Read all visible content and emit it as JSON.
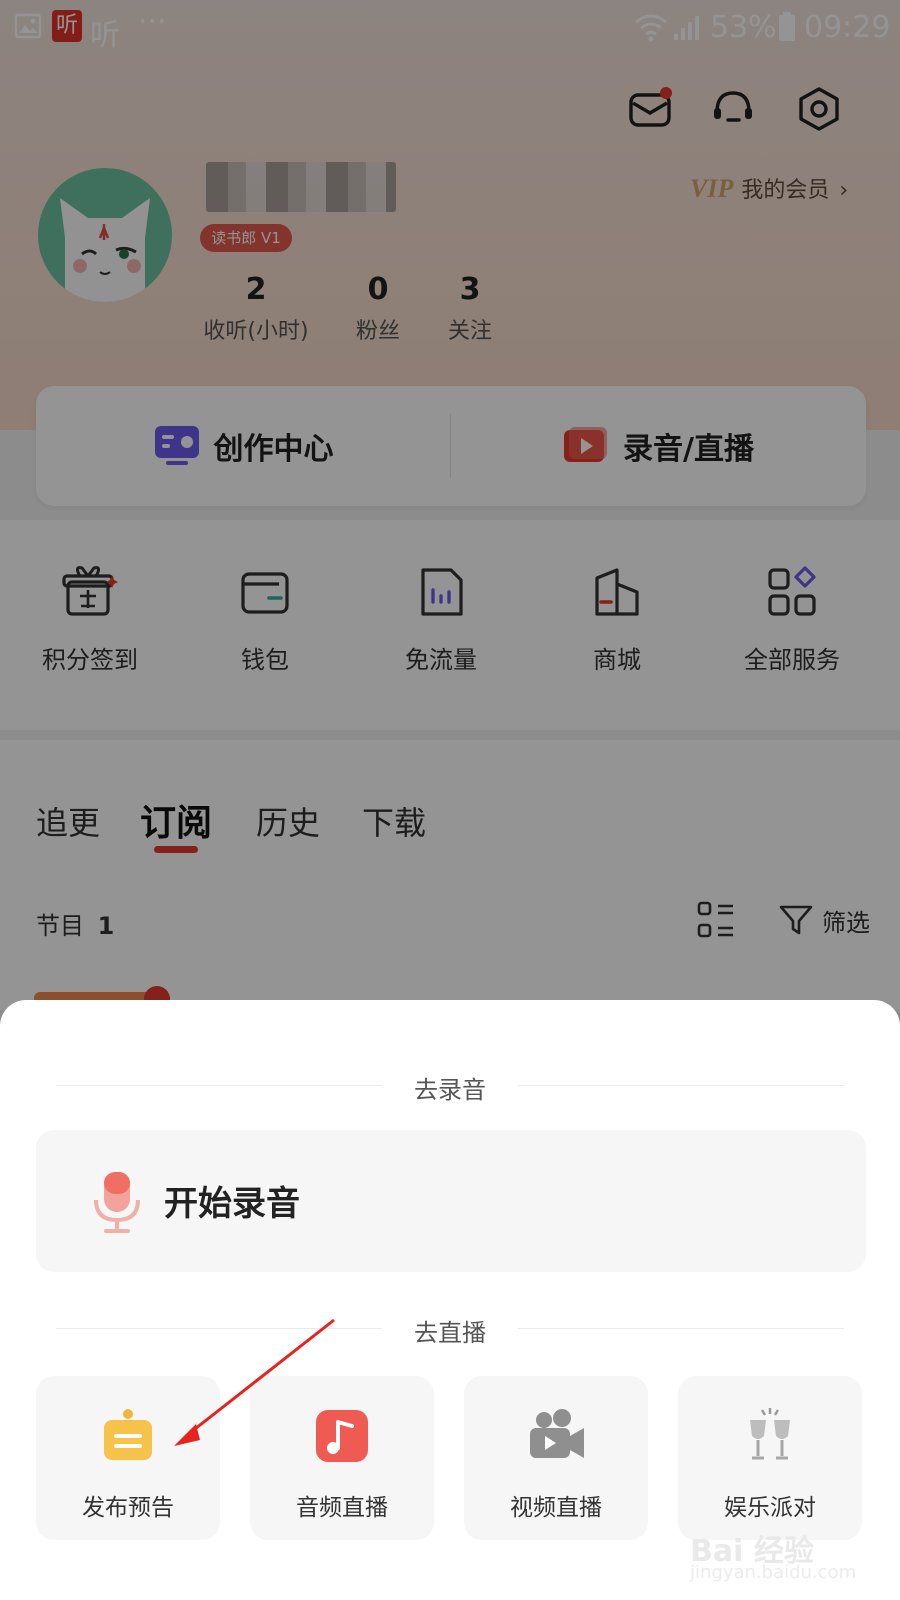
{
  "status_bar": {
    "battery": "53%",
    "time": "09:29",
    "app_badge": "听",
    "app_name": "听",
    "more": "···"
  },
  "profile": {
    "level_badge": "读书郎 V1",
    "vip_logo": "VIP",
    "vip_label": "我的会员",
    "stats": [
      {
        "value": "2",
        "label": "收听(小时)"
      },
      {
        "value": "0",
        "label": "粉丝"
      },
      {
        "value": "3",
        "label": "关注"
      }
    ]
  },
  "creator_card": {
    "left_label": "创作中心",
    "right_label": "录音/直播"
  },
  "services": [
    {
      "label": "积分签到",
      "icon": "gift-sign-icon"
    },
    {
      "label": "钱包",
      "icon": "wallet-icon"
    },
    {
      "label": "免流量",
      "icon": "data-chart-icon"
    },
    {
      "label": "商城",
      "icon": "shop-icon"
    },
    {
      "label": "全部服务",
      "icon": "grid-services-icon"
    }
  ],
  "tabs": [
    "追更",
    "订阅",
    "历史",
    "下载"
  ],
  "active_tab": "订阅",
  "list_header": {
    "label": "节目",
    "count": "1",
    "filter_label": "筛选"
  },
  "sheet": {
    "record_section": "去录音",
    "record_button": "开始录音",
    "live_section": "去直播",
    "live_options": [
      {
        "label": "发布预告",
        "icon": "announcement-icon"
      },
      {
        "label": "音频直播",
        "icon": "music-note-icon"
      },
      {
        "label": "视频直播",
        "icon": "video-camera-icon"
      },
      {
        "label": "娱乐派对",
        "icon": "party-cheers-icon"
      }
    ]
  },
  "watermark": {
    "brand": "Bai 经验",
    "url": "jingyan.baidu.com"
  }
}
